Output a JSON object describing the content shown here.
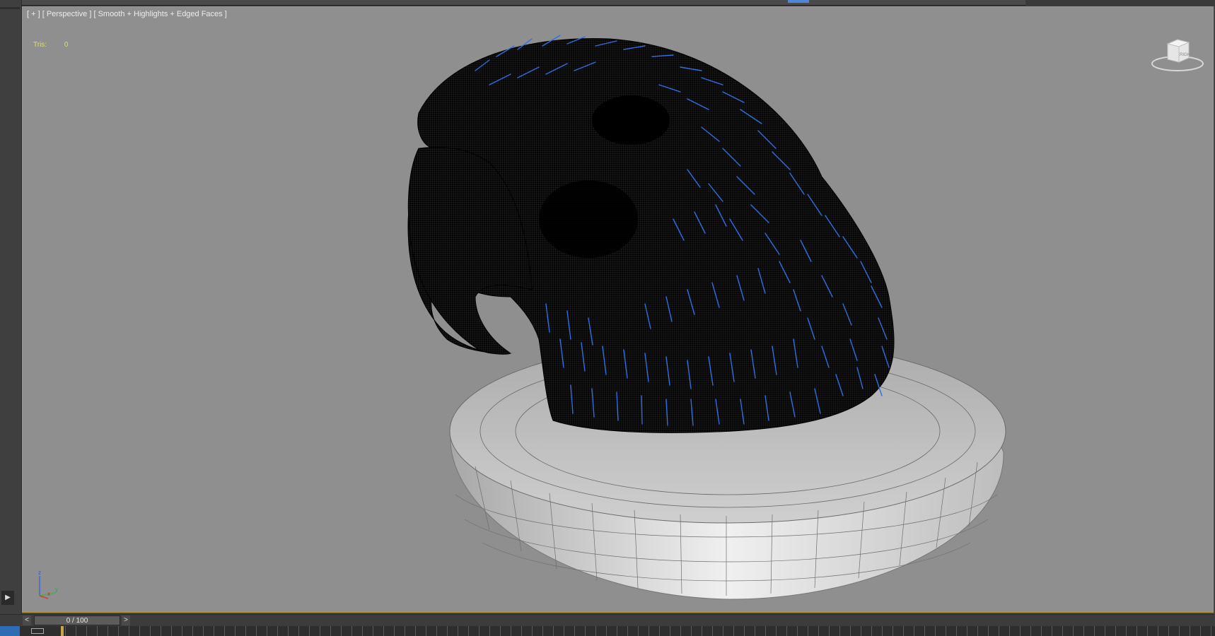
{
  "viewport": {
    "label": "[ + ] [ Perspective ] [ Smooth + Highlights + Edged Faces ]",
    "stats_label": "Tris:",
    "stats_value": "0",
    "viewcube_face": "RIGHT",
    "axis_labels": {
      "z": "z",
      "x": "x",
      "y": "y"
    }
  },
  "timeline": {
    "prev": "<",
    "frame_display": "0 / 100",
    "next": ">"
  },
  "icons": {
    "play": "play-icon",
    "viewcube": "viewcube-icon",
    "axis": "axis-gizmo-icon",
    "key": "key-mode-icon"
  },
  "colors": {
    "viewport_bg": "#8f8f8f",
    "active_border": "#b99a35",
    "stats_text": "#e4e436",
    "hair": "#2f6fe0",
    "mesh": "#050505",
    "base": "#d8d8d8"
  }
}
